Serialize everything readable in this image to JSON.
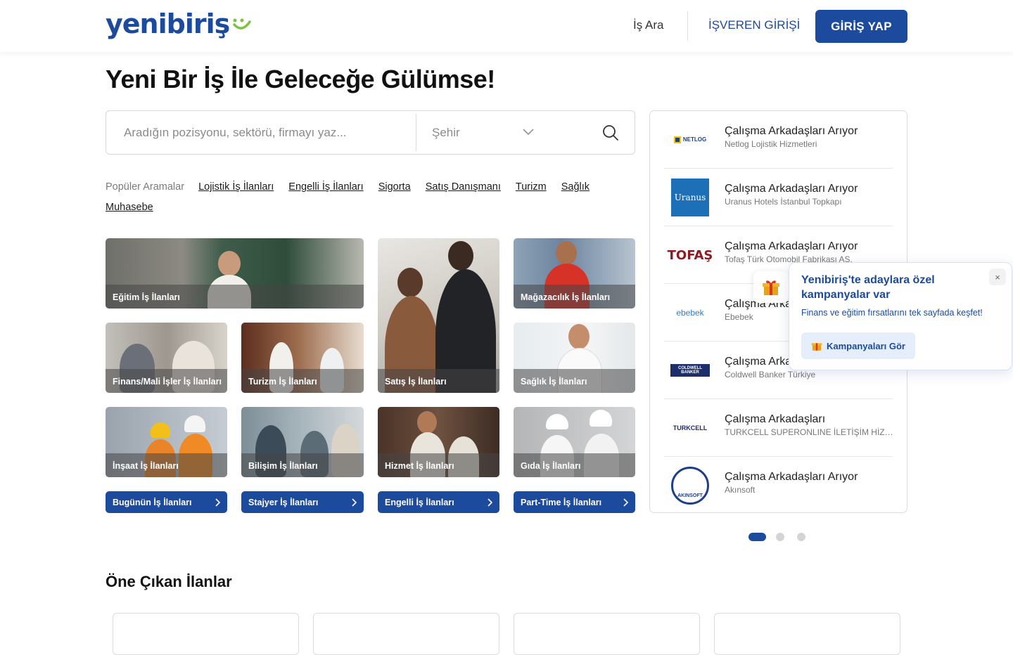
{
  "header": {
    "logo_text": "yenibiriş",
    "nav_search": "İş Ara",
    "nav_employer": "İŞVEREN GİRİŞİ",
    "login_button": "GİRİŞ YAP",
    "brand_color": "#1c4a9c",
    "accent_color": "#7cc143"
  },
  "hero": {
    "title": "Yeni Bir İş İle Geleceğe Gülümse!"
  },
  "search": {
    "placeholder": "Aradığın pozisyonu, sektörü, firmayı yaz...",
    "city_placeholder": "Şehir"
  },
  "popular": {
    "label": "Popüler Aramalar",
    "items": [
      "Lojistik İş İlanları",
      "Engelli İş İlanları",
      "Sigorta",
      "Satış Danışmanı",
      "Turizm",
      "Sağlık",
      "Muhasebe"
    ]
  },
  "categories": [
    {
      "label": "Eğitim İş İlanları"
    },
    {
      "label": "Satış İş İlanları"
    },
    {
      "label": "Mağazacılık İş İlanları"
    },
    {
      "label": "Finans/Mali İşler İş İlanları"
    },
    {
      "label": "Turizm İş İlanları"
    },
    {
      "label": "Sağlık İş İlanları"
    },
    {
      "label": "İnşaat İş İlanları"
    },
    {
      "label": "Bilişim İş İlanları"
    },
    {
      "label": "Hizmet İş İlanları"
    },
    {
      "label": "Gıda İş İlanları"
    }
  ],
  "quick_links": [
    {
      "label": "Bugünün İş İlanları"
    },
    {
      "label": "Stajyer İş İlanları"
    },
    {
      "label": "Engelli İş İlanları"
    },
    {
      "label": "Part-Time İş İlanları"
    }
  ],
  "companies": [
    {
      "title": "Çalışma Arkadaşları Arıyor",
      "name": "Netlog Lojistik Hizmetleri",
      "logo": "NETLOG"
    },
    {
      "title": "Çalışma Arkadaşları Arıyor",
      "name": "Uranus Hotels İstanbul Topkapı",
      "logo": "Uranus"
    },
    {
      "title": "Çalışma Arkadaşları Arıyor",
      "name": "Tofaş Türk Otomobil Fabrikası AS.",
      "logo": "TOFAŞ"
    },
    {
      "title": "Çalışma Arkadaşları Arıyor",
      "name": "Ebebek",
      "logo": "ebebek"
    },
    {
      "title": "Çalışma Arkadaşları Arıyor",
      "name": "Coldwell Banker Türkiye",
      "logo": "COLDWELL BANKER"
    },
    {
      "title": "Çalışma Arkadaşları",
      "name": "TURKCELL SUPERONLINE İLETİŞİM HİZMETLERİ",
      "logo": "TURKCELL"
    },
    {
      "title": "Çalışma Arkadaşları Arıyor",
      "name": "Akınsoft",
      "logo": "AKINSOFT"
    }
  ],
  "carousel": {
    "pages": 3,
    "active": 1
  },
  "campaign_popup": {
    "title": "Yenibiriş'te adaylara özel kampanyalar var",
    "text": "Finans ve eğitim fırsatlarını tek sayfada keşfet!",
    "button": "Kampanyaları Gör",
    "close": "×"
  },
  "featured": {
    "title": "Öne Çıkan İlanlar"
  }
}
